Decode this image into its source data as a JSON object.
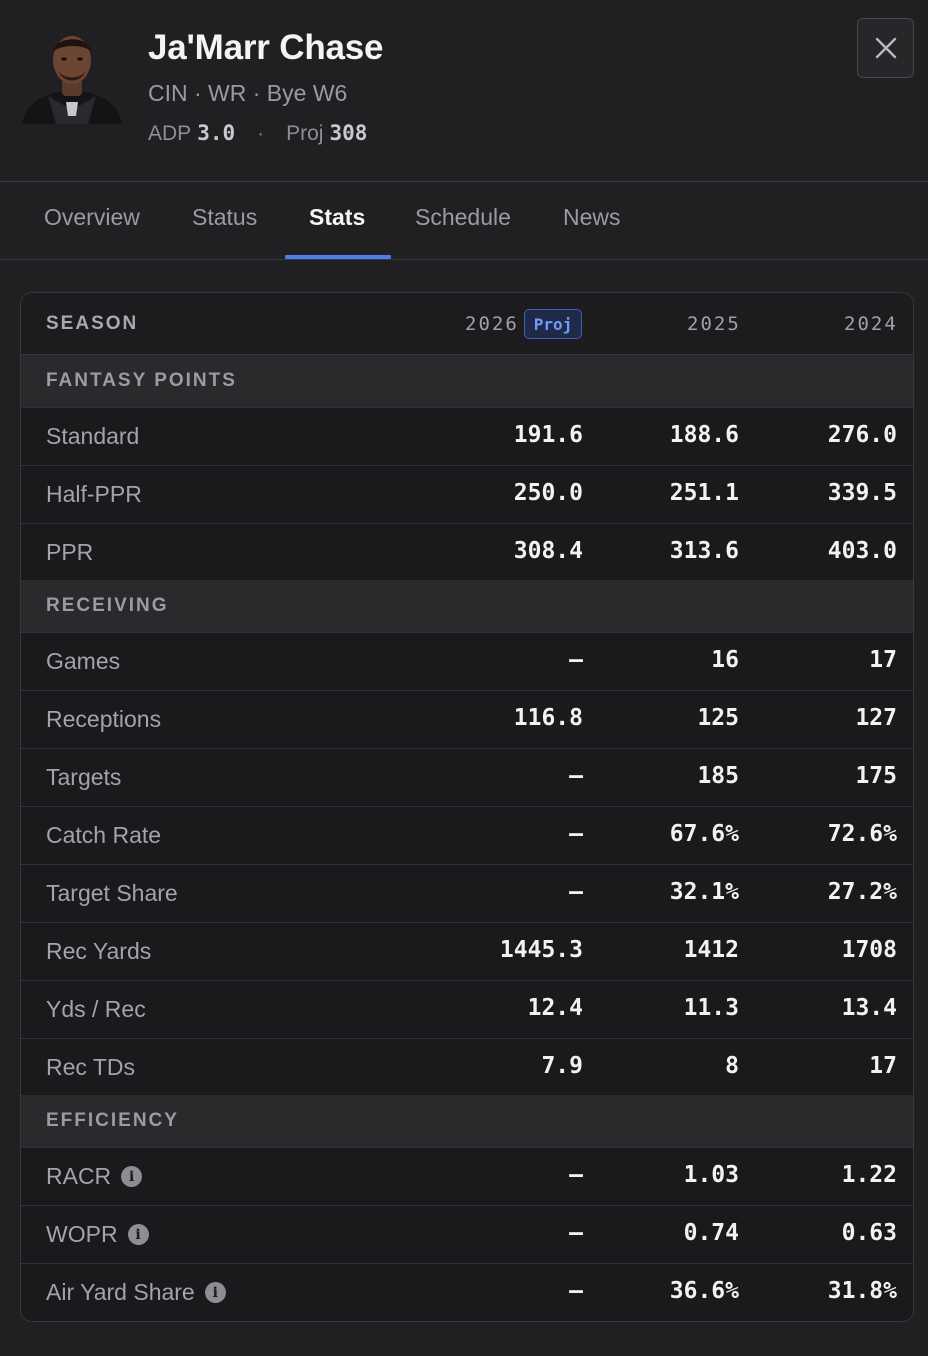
{
  "player": {
    "name": "Ja'Marr Chase",
    "meta": "CIN · WR · Bye W6",
    "adp_label": "ADP",
    "adp_value": "3.0",
    "proj_label": "Proj",
    "proj_value": "308"
  },
  "tabs": [
    {
      "label": "Overview",
      "active": false
    },
    {
      "label": "Status",
      "active": false
    },
    {
      "label": "Stats",
      "active": true
    },
    {
      "label": "Schedule",
      "active": false
    },
    {
      "label": "News",
      "active": false
    }
  ],
  "table": {
    "season_header": "SEASON",
    "years": [
      "2026",
      "2025",
      "2024"
    ],
    "proj_badge": "Proj",
    "sections": {
      "fantasy": "FANTASY POINTS",
      "receiving": "RECEIVING",
      "efficiency": "EFFICIENCY"
    },
    "rows": [
      {
        "label": "Standard",
        "values": [
          "191.6",
          "188.6",
          "276.0"
        ]
      },
      {
        "label": "Half-PPR",
        "values": [
          "250.0",
          "251.1",
          "339.5"
        ]
      },
      {
        "label": "PPR",
        "values": [
          "308.4",
          "313.6",
          "403.0"
        ]
      },
      {
        "label": "Games",
        "values": [
          "–",
          "16",
          "17"
        ]
      },
      {
        "label": "Receptions",
        "values": [
          "116.8",
          "125",
          "127"
        ]
      },
      {
        "label": "Targets",
        "values": [
          "–",
          "185",
          "175"
        ]
      },
      {
        "label": "Catch Rate",
        "values": [
          "–",
          "67.6%",
          "72.6%"
        ]
      },
      {
        "label": "Target Share",
        "values": [
          "–",
          "32.1%",
          "27.2%"
        ]
      },
      {
        "label": "Rec Yards",
        "values": [
          "1445.3",
          "1412",
          "1708"
        ]
      },
      {
        "label": "Yds / Rec",
        "values": [
          "12.4",
          "11.3",
          "13.4"
        ]
      },
      {
        "label": "Rec TDs",
        "values": [
          "7.9",
          "8",
          "17"
        ]
      },
      {
        "label": "RACR",
        "values": [
          "–",
          "1.03",
          "1.22"
        ]
      },
      {
        "label": "WOPR",
        "values": [
          "–",
          "0.74",
          "0.63"
        ]
      },
      {
        "label": "Air Yard Share",
        "values": [
          "–",
          "36.6%",
          "31.8%"
        ]
      }
    ]
  },
  "colors": {
    "background": "#202022",
    "accent": "#4c7df0",
    "badge_text": "#6f9bff"
  },
  "icons": {
    "close": "close-icon",
    "info": "info-icon"
  }
}
